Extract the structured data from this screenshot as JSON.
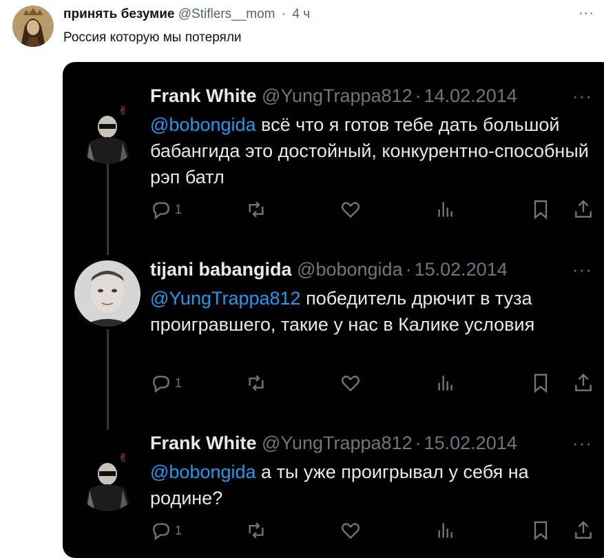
{
  "outer": {
    "name": "принять безумие",
    "handle": "@Stiflers__mom",
    "separator": "·",
    "time": "4 ч",
    "more": "···",
    "text": "Россия которую мы потеряли"
  },
  "tweets": [
    {
      "name": "Frank White",
      "handle": "@YungTrappa812",
      "separator": "·",
      "date": "14.02.2014",
      "more": "···",
      "mention": "@bobongida",
      "text": " всё что я готов тебе дать большой бабангида это достойный, конкурентно-способный рэп батл",
      "reply_count": "1"
    },
    {
      "name": "tijani babangida",
      "handle": "@bobongida",
      "separator": "·",
      "date": "15.02.2014",
      "more": "···",
      "mention": "@YungTrappa812",
      "text": " победитель дрючит в туза проигравшего, такие у нас в Калике условия",
      "reply_count": "1"
    },
    {
      "name": "Frank White",
      "handle": "@YungTrappa812",
      "separator": "·",
      "date": "15.02.2014",
      "more": "···",
      "mention": "@bobongida",
      "text": " а ты уже проигрывал у себя на родине?",
      "reply_count": "1"
    }
  ],
  "icons": {
    "reply": "reply-icon",
    "retweet": "retweet-icon",
    "like": "heart-icon",
    "views": "views-icon",
    "bookmark": "bookmark-icon",
    "share": "share-icon"
  },
  "colors": {
    "accent": "#1d9bf0",
    "dark_bg": "#000000",
    "dark_text": "#e7e9ea",
    "muted": "#71767b"
  }
}
